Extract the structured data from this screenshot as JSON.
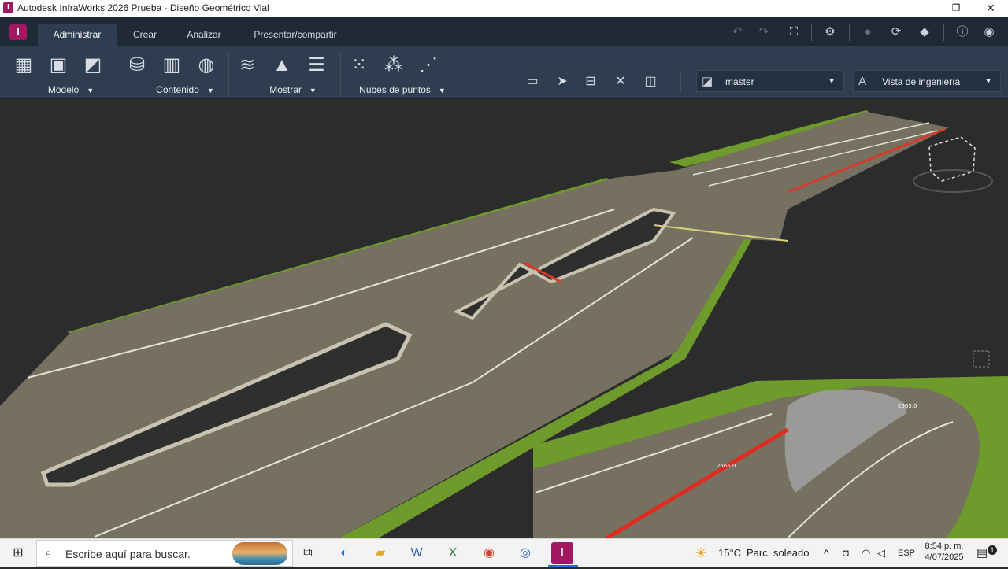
{
  "window": {
    "title": "Autodesk InfraWorks 2026 Prueba - Diseño Geométrico Vial",
    "app_badge": "I",
    "minimize": "–",
    "maximize": "❐",
    "close": "✕"
  },
  "ribbon": {
    "logo": "I",
    "tabs": [
      {
        "label": "Administrar",
        "active": true
      },
      {
        "label": "Crear",
        "active": false
      },
      {
        "label": "Analizar",
        "active": false
      },
      {
        "label": "Presentar/compartir",
        "active": false
      }
    ],
    "quick_icons": [
      "undo-icon",
      "redo-icon",
      "fit-view-icon",
      "settings-icon",
      "globe-icon",
      "sync-icon",
      "model-cube-icon",
      "help-icon",
      "user-avatar-icon"
    ],
    "groups": [
      {
        "label": "Modelo",
        "icons": [
          "model-properties-icon",
          "model-layout-icon",
          "model-map-icon"
        ]
      },
      {
        "label": "Contenido",
        "icons": [
          "data-sources-icon",
          "building-icon",
          "web-globe-icon"
        ]
      },
      {
        "label": "Mostrar",
        "icons": [
          "layers-icon",
          "terrain-icon",
          "list-panel-icon"
        ]
      },
      {
        "label": "Nubes de puntos",
        "icons": [
          "pointcloud-import-icon",
          "pointcloud-terrain-icon",
          "pointcloud-edit-icon"
        ]
      }
    ],
    "tools": [
      "view-screen-icon",
      "select-pointer-icon",
      "measure-icon",
      "transform-icon",
      "panel-icon"
    ],
    "proposal_dropdown": {
      "value": "master"
    },
    "view_dropdown": {
      "value": "Vista de ingeniería"
    }
  },
  "viewport": {
    "label_1": "2565.0",
    "label_2": "2565.0"
  },
  "taskbar": {
    "search_placeholder": "Escribe aquí para buscar.",
    "apps": [
      "task-view-icon",
      "edge-icon",
      "file-explorer-icon",
      "word-icon",
      "excel-icon",
      "chrome-icon",
      "app-blue-icon",
      "infraworks-icon"
    ],
    "weather_temp": "15°C",
    "weather_text": "Parc. soleado",
    "lang": "ESP",
    "time": "8:54 p. m.",
    "date": "4/07/2025",
    "notifications": "1"
  }
}
